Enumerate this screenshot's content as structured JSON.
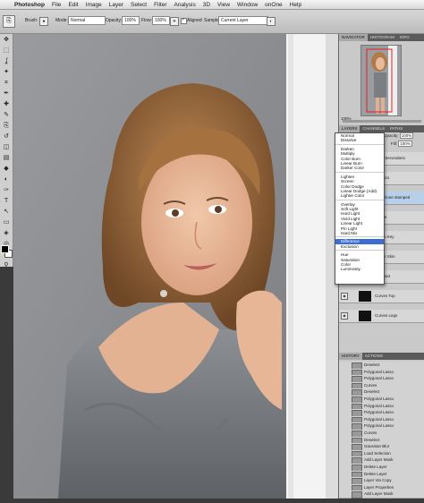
{
  "menubar": {
    "app": "Photoshop",
    "items": [
      "File",
      "Edit",
      "Image",
      "Layer",
      "Select",
      "Filter",
      "Analysis",
      "3D",
      "View",
      "Window",
      "onOne",
      "Help"
    ],
    "badge": "Ps",
    "zoom": "100%"
  },
  "options": {
    "brush_label": "Brush:",
    "mode_label": "Mode:",
    "mode_value": "Normal",
    "opacity_label": "Opacity:",
    "opacity_value": "100%",
    "flow_label": "Flow:",
    "flow_value": "100%",
    "aligned_label": "Aligned",
    "sample_label": "Sample:",
    "sample_value": "Current Layer"
  },
  "toolbox": {
    "tools": [
      "move-tool",
      "marquee-tool",
      "lasso-tool",
      "magic-wand-tool",
      "crop-tool",
      "eyedropper-tool",
      "healing-tool",
      "brush-tool",
      "clone-stamp-tool",
      "history-brush-tool",
      "eraser-tool",
      "gradient-tool",
      "blur-tool",
      "dodge-tool",
      "pen-tool",
      "type-tool",
      "path-select-tool",
      "shape-tool",
      "3d-tool",
      "3d-camera-tool",
      "hand-tool",
      "zoom-tool"
    ],
    "glyphs": [
      "✥",
      "⬚",
      "ʆ",
      "✦",
      "⌗",
      "✒",
      "✚",
      "✎",
      "⎘",
      "↺",
      "◫",
      "▤",
      "◆",
      "◐",
      "✑",
      "T",
      "↖",
      "▭",
      "◈",
      "◎",
      "✋",
      "⚲"
    ],
    "foreground_color": "#000000",
    "background_color": "#ffffff"
  },
  "navigator": {
    "tabs": [
      "NAVIGATOR",
      "HISTOGRAM",
      "INFO"
    ],
    "zoom": "100%"
  },
  "layers": {
    "tabs": [
      "LAYERS",
      "CHANNELS",
      "PATHS"
    ],
    "opacity_label": "Opacity:",
    "opacity_value": "100%",
    "fill_label": "Fill:",
    "fill_value": "100%",
    "rows": [
      {
        "name": "Piani Secondario",
        "thumb": "white"
      },
      {
        "name": "Lorenzo",
        "thumb": "white"
      },
      {
        "name": "Skin clone stamped",
        "thumb": "white",
        "selected": true
      },
      {
        "name": "Dodge",
        "thumb": "white"
      },
      {
        "name": "Group Key",
        "thumb": "white"
      },
      {
        "name": "Group Skin",
        "thumb": "white"
      },
      {
        "name": "Contrast",
        "thumb": "black"
      },
      {
        "name": "Curves Top",
        "thumb": "black"
      },
      {
        "name": "Curves Legs",
        "thumb": "black"
      }
    ]
  },
  "blend_modes": {
    "groups": [
      [
        "Normal",
        "Dissolve"
      ],
      [
        "Darken",
        "Multiply",
        "Color Burn",
        "Linear Burn",
        "Darker Color"
      ],
      [
        "Lighten",
        "Screen",
        "Color Dodge",
        "Linear Dodge (Add)",
        "Lighter Color"
      ],
      [
        "Overlay",
        "Soft Light",
        "Hard Light",
        "Vivid Light",
        "Linear Light",
        "Pin Light",
        "Hard Mix"
      ],
      [
        "Difference",
        "Exclusion"
      ],
      [
        "Hue",
        "Saturation",
        "Color",
        "Luminosity"
      ]
    ],
    "selected": "Difference"
  },
  "history": {
    "tabs": [
      "HISTORY",
      "ACTIONS"
    ],
    "items": [
      "Deselect",
      "Polygonal Lasso",
      "Polygonal Lasso",
      "Curves",
      "Deselect",
      "Polygonal Lasso",
      "Polygonal Lasso",
      "Polygonal Lasso",
      "Polygonal Lasso",
      "Polygonal Lasso",
      "Curves",
      "Deselect",
      "Gaussian Blur",
      "Load Selection",
      "Add Layer Mask",
      "Delete Layer",
      "Delete Layer",
      "Layer Via Copy",
      "Layer Properties",
      "Add Layer Mask"
    ]
  }
}
